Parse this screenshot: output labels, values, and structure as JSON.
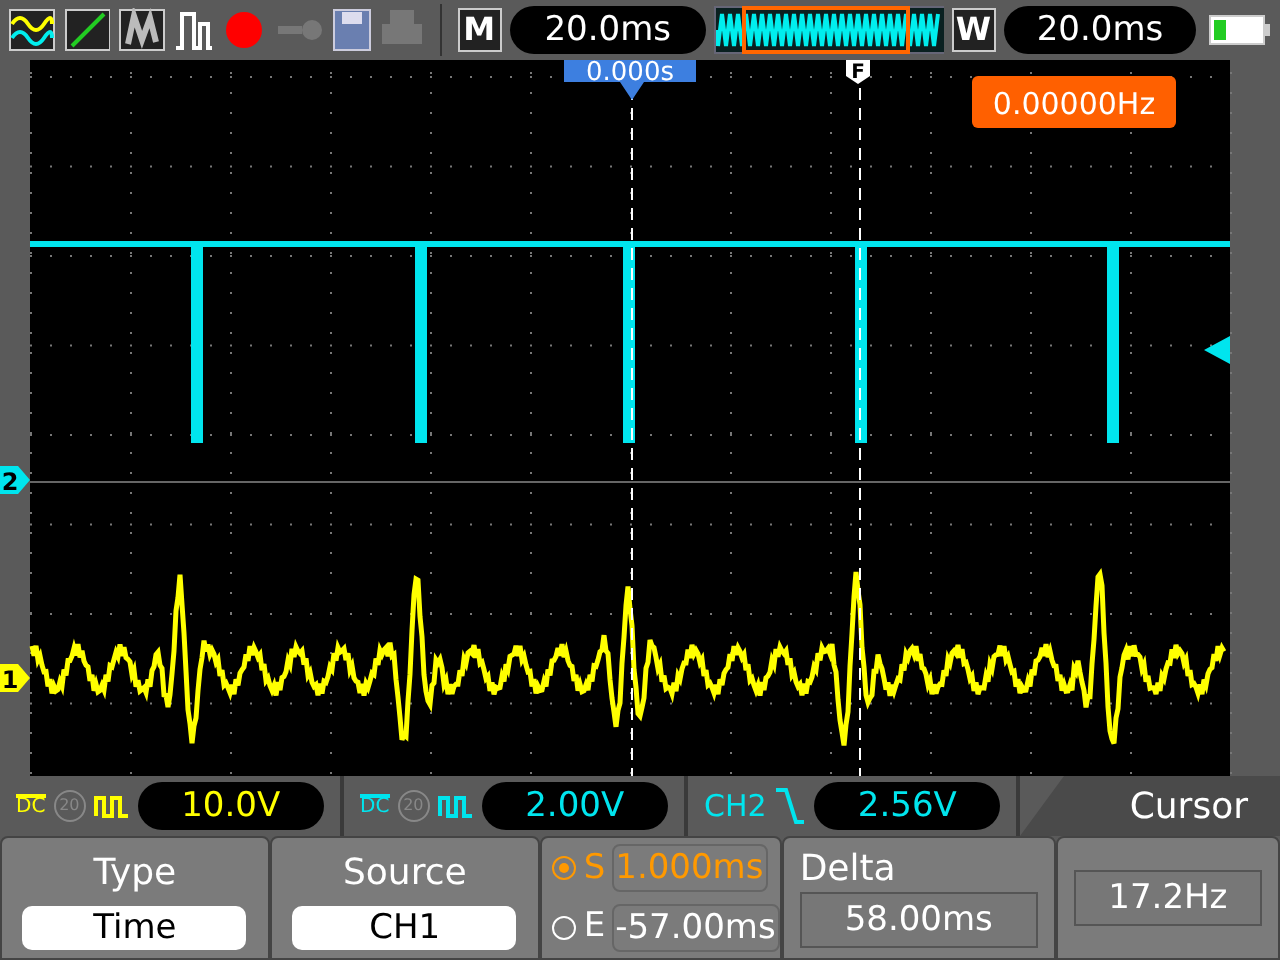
{
  "toolbar": {
    "main_label": "M",
    "timebase": "20.0ms",
    "window_label": "W",
    "window_timebase": "20.0ms",
    "recording": true
  },
  "screen": {
    "trigger_position": "0.000s",
    "trigger_marker": "F",
    "frequency": "0.00000Hz",
    "channel_markers": [
      {
        "label": "2",
        "color": "#00e5ee"
      },
      {
        "label": "1",
        "color": "#ffff00"
      }
    ]
  },
  "channel_bar": [
    {
      "kind": "channel",
      "coupling": "DC",
      "bw_limit": "20",
      "scale": "10.0V",
      "color": "#ffff00"
    },
    {
      "kind": "channel",
      "coupling": "DC",
      "bw_limit": "20",
      "scale": "2.00V",
      "color": "#00e5ee"
    },
    {
      "kind": "trigger",
      "source": "CH2",
      "level": "2.56V",
      "color": "#00e5ee"
    }
  ],
  "menu_title": "Cursor",
  "menu": [
    {
      "kind": "option",
      "label": "Type",
      "value": "Time"
    },
    {
      "kind": "option",
      "label": "Source",
      "value": "CH1"
    },
    {
      "kind": "cursors",
      "items": [
        {
          "label": "S",
          "value": "1.000ms",
          "selected": true
        },
        {
          "label": "E",
          "value": "-57.00ms",
          "selected": false
        }
      ]
    },
    {
      "kind": "readout",
      "label": "Delta",
      "value": "58.00ms"
    },
    {
      "kind": "readout",
      "value": "17.2Hz"
    }
  ]
}
